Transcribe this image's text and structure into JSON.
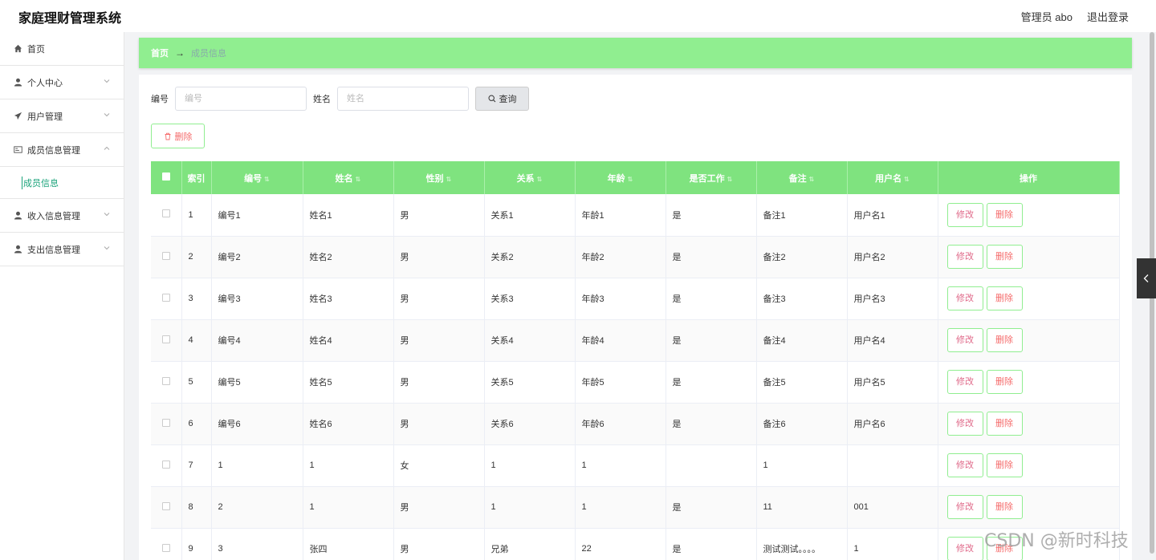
{
  "app": {
    "title": "家庭理财管理系统",
    "user": "管理员 abo",
    "logout": "退出登录"
  },
  "sidebar": {
    "items": [
      {
        "label": "首页",
        "icon": "home-icon"
      },
      {
        "label": "个人中心",
        "icon": "user-icon"
      },
      {
        "label": "用户管理",
        "icon": "send-icon"
      },
      {
        "label": "成员信息管理",
        "icon": "id-card-icon"
      },
      {
        "label": "收入信息管理",
        "icon": "user-icon"
      },
      {
        "label": "支出信息管理",
        "icon": "user-icon"
      }
    ],
    "sub_item": "成员信息"
  },
  "breadcrumb": {
    "home": "首页",
    "arrow": "→",
    "current": "成员信息"
  },
  "search": {
    "id_label": "编号",
    "id_placeholder": "编号",
    "name_label": "姓名",
    "name_placeholder": "姓名",
    "query_button": "查询"
  },
  "delete_button": "删除",
  "table": {
    "headers": [
      "索引",
      "编号",
      "姓名",
      "性别",
      "关系",
      "年龄",
      "是否工作",
      "备注",
      "用户名",
      "操作"
    ],
    "edit_label": "修改",
    "delete_label": "删除",
    "rows": [
      [
        "1",
        "编号1",
        "姓名1",
        "男",
        "关系1",
        "年龄1",
        "是",
        "备注1",
        "用户名1"
      ],
      [
        "2",
        "编号2",
        "姓名2",
        "男",
        "关系2",
        "年龄2",
        "是",
        "备注2",
        "用户名2"
      ],
      [
        "3",
        "编号3",
        "姓名3",
        "男",
        "关系3",
        "年龄3",
        "是",
        "备注3",
        "用户名3"
      ],
      [
        "4",
        "编号4",
        "姓名4",
        "男",
        "关系4",
        "年龄4",
        "是",
        "备注4",
        "用户名4"
      ],
      [
        "5",
        "编号5",
        "姓名5",
        "男",
        "关系5",
        "年龄5",
        "是",
        "备注5",
        "用户名5"
      ],
      [
        "6",
        "编号6",
        "姓名6",
        "男",
        "关系6",
        "年龄6",
        "是",
        "备注6",
        "用户名6"
      ],
      [
        "7",
        "1",
        "1",
        "女",
        "1",
        "1",
        "",
        "1",
        ""
      ],
      [
        "8",
        "2",
        "1",
        "男",
        "1",
        "1",
        "是",
        "11",
        "001"
      ],
      [
        "9",
        "3",
        "张四",
        "男",
        "兄弟",
        "22",
        "是",
        "测试测试。。。。",
        "1"
      ]
    ]
  },
  "watermark": "CSDN @新时科技",
  "colors": {
    "accent": "#90ee90",
    "header": "#7fe37f",
    "danger": "#f56c6c"
  }
}
